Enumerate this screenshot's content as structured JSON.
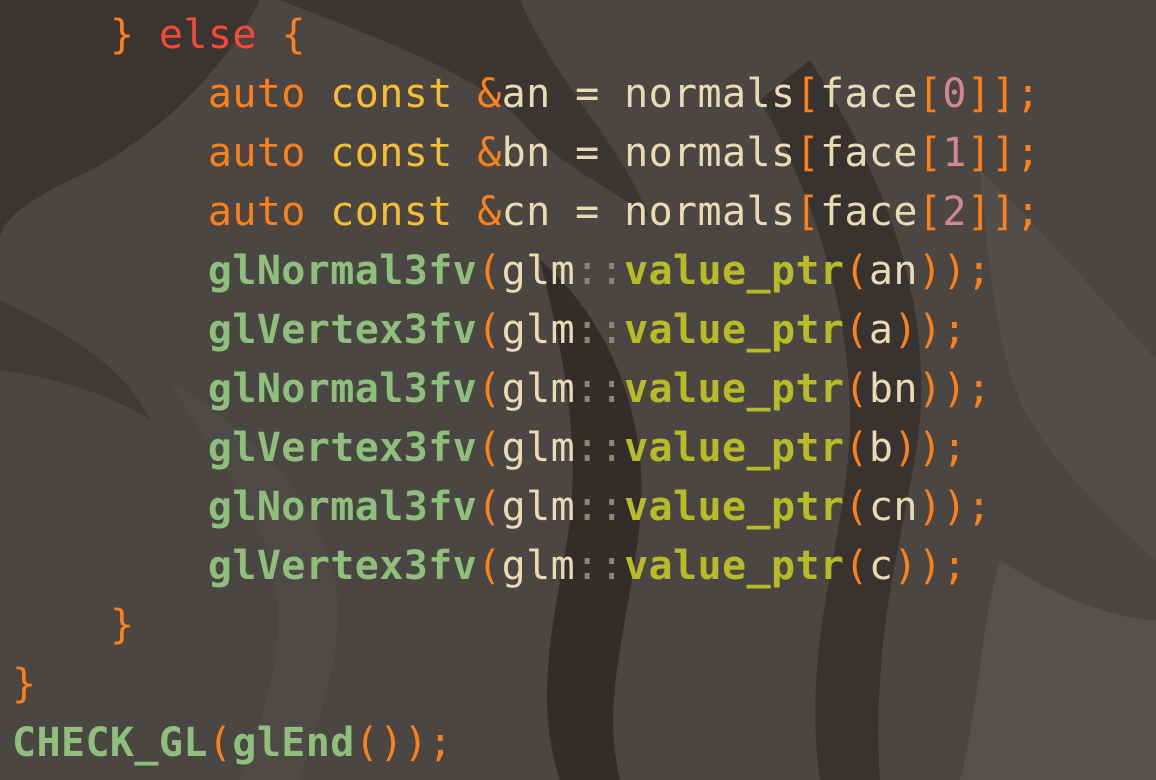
{
  "colors": {
    "background": "#4a4643",
    "plain_text": "#ebdbb2",
    "keyword_orange": "#fe8019",
    "keyword_yellow": "#fabd2f",
    "keyword_red": "#fb4934",
    "function_green": "#8ec07c",
    "method_yellow_green": "#b8bb26",
    "number_purple": "#d3869b",
    "punctuation_gray": "#928374"
  },
  "editor": {
    "lines": [
      {
        "indent": "    ",
        "tokens": [
          {
            "text": "}",
            "color": "#fe8019"
          },
          {
            "text": " ",
            "color": "#ebdbb2"
          },
          {
            "text": "else",
            "color": "#fb4934"
          },
          {
            "text": " ",
            "color": "#ebdbb2"
          },
          {
            "text": "{",
            "color": "#fe8019"
          }
        ]
      },
      {
        "indent": "        ",
        "tokens": [
          {
            "text": "auto",
            "color": "#fe8019"
          },
          {
            "text": " ",
            "color": "#ebdbb2"
          },
          {
            "text": "const",
            "color": "#fabd2f"
          },
          {
            "text": " ",
            "color": "#ebdbb2"
          },
          {
            "text": "&",
            "color": "#fe8019"
          },
          {
            "text": "an",
            "color": "#ebdbb2"
          },
          {
            "text": " ",
            "color": "#ebdbb2"
          },
          {
            "text": "=",
            "color": "#ebdbb2"
          },
          {
            "text": " ",
            "color": "#ebdbb2"
          },
          {
            "text": "normals",
            "color": "#ebdbb2"
          },
          {
            "text": "[",
            "color": "#fe8019"
          },
          {
            "text": "face",
            "color": "#ebdbb2"
          },
          {
            "text": "[",
            "color": "#fe8019"
          },
          {
            "text": "0",
            "color": "#d3869b"
          },
          {
            "text": "]]",
            "color": "#fe8019"
          },
          {
            "text": ";",
            "color": "#fe8019"
          }
        ]
      },
      {
        "indent": "        ",
        "tokens": [
          {
            "text": "auto",
            "color": "#fe8019"
          },
          {
            "text": " ",
            "color": "#ebdbb2"
          },
          {
            "text": "const",
            "color": "#fabd2f"
          },
          {
            "text": " ",
            "color": "#ebdbb2"
          },
          {
            "text": "&",
            "color": "#fe8019"
          },
          {
            "text": "bn",
            "color": "#ebdbb2"
          },
          {
            "text": " ",
            "color": "#ebdbb2"
          },
          {
            "text": "=",
            "color": "#ebdbb2"
          },
          {
            "text": " ",
            "color": "#ebdbb2"
          },
          {
            "text": "normals",
            "color": "#ebdbb2"
          },
          {
            "text": "[",
            "color": "#fe8019"
          },
          {
            "text": "face",
            "color": "#ebdbb2"
          },
          {
            "text": "[",
            "color": "#fe8019"
          },
          {
            "text": "1",
            "color": "#d3869b"
          },
          {
            "text": "]]",
            "color": "#fe8019"
          },
          {
            "text": ";",
            "color": "#fe8019"
          }
        ]
      },
      {
        "indent": "        ",
        "tokens": [
          {
            "text": "auto",
            "color": "#fe8019"
          },
          {
            "text": " ",
            "color": "#ebdbb2"
          },
          {
            "text": "const",
            "color": "#fabd2f"
          },
          {
            "text": " ",
            "color": "#ebdbb2"
          },
          {
            "text": "&",
            "color": "#fe8019"
          },
          {
            "text": "cn",
            "color": "#ebdbb2"
          },
          {
            "text": " ",
            "color": "#ebdbb2"
          },
          {
            "text": "=",
            "color": "#ebdbb2"
          },
          {
            "text": " ",
            "color": "#ebdbb2"
          },
          {
            "text": "normals",
            "color": "#ebdbb2"
          },
          {
            "text": "[",
            "color": "#fe8019"
          },
          {
            "text": "face",
            "color": "#ebdbb2"
          },
          {
            "text": "[",
            "color": "#fe8019"
          },
          {
            "text": "2",
            "color": "#d3869b"
          },
          {
            "text": "]]",
            "color": "#fe8019"
          },
          {
            "text": ";",
            "color": "#fe8019"
          }
        ]
      },
      {
        "indent": "        ",
        "tokens": [
          {
            "text": "glNormal3fv",
            "color": "#8ec07c",
            "bold": true
          },
          {
            "text": "(",
            "color": "#fe8019"
          },
          {
            "text": "glm",
            "color": "#ebdbb2"
          },
          {
            "text": "::",
            "color": "#928374"
          },
          {
            "text": "value_ptr",
            "color": "#b8bb26",
            "bold": true
          },
          {
            "text": "(",
            "color": "#fe8019"
          },
          {
            "text": "an",
            "color": "#ebdbb2"
          },
          {
            "text": "))",
            "color": "#fe8019"
          },
          {
            "text": ";",
            "color": "#fe8019"
          }
        ]
      },
      {
        "indent": "        ",
        "tokens": [
          {
            "text": "glVertex3fv",
            "color": "#8ec07c",
            "bold": true
          },
          {
            "text": "(",
            "color": "#fe8019"
          },
          {
            "text": "glm",
            "color": "#ebdbb2"
          },
          {
            "text": "::",
            "color": "#928374"
          },
          {
            "text": "value_ptr",
            "color": "#b8bb26",
            "bold": true
          },
          {
            "text": "(",
            "color": "#fe8019"
          },
          {
            "text": "a",
            "color": "#ebdbb2"
          },
          {
            "text": "))",
            "color": "#fe8019"
          },
          {
            "text": ";",
            "color": "#fe8019"
          }
        ]
      },
      {
        "indent": "        ",
        "tokens": [
          {
            "text": "glNormal3fv",
            "color": "#8ec07c",
            "bold": true
          },
          {
            "text": "(",
            "color": "#fe8019"
          },
          {
            "text": "glm",
            "color": "#ebdbb2"
          },
          {
            "text": "::",
            "color": "#928374"
          },
          {
            "text": "value_ptr",
            "color": "#b8bb26",
            "bold": true
          },
          {
            "text": "(",
            "color": "#fe8019"
          },
          {
            "text": "bn",
            "color": "#ebdbb2"
          },
          {
            "text": "))",
            "color": "#fe8019"
          },
          {
            "text": ";",
            "color": "#fe8019"
          }
        ]
      },
      {
        "indent": "        ",
        "tokens": [
          {
            "text": "glVertex3fv",
            "color": "#8ec07c",
            "bold": true
          },
          {
            "text": "(",
            "color": "#fe8019"
          },
          {
            "text": "glm",
            "color": "#ebdbb2"
          },
          {
            "text": "::",
            "color": "#928374"
          },
          {
            "text": "value_ptr",
            "color": "#b8bb26",
            "bold": true
          },
          {
            "text": "(",
            "color": "#fe8019"
          },
          {
            "text": "b",
            "color": "#ebdbb2"
          },
          {
            "text": "))",
            "color": "#fe8019"
          },
          {
            "text": ";",
            "color": "#fe8019"
          }
        ]
      },
      {
        "indent": "        ",
        "tokens": [
          {
            "text": "glNormal3fv",
            "color": "#8ec07c",
            "bold": true
          },
          {
            "text": "(",
            "color": "#fe8019"
          },
          {
            "text": "glm",
            "color": "#ebdbb2"
          },
          {
            "text": "::",
            "color": "#928374"
          },
          {
            "text": "value_ptr",
            "color": "#b8bb26",
            "bold": true
          },
          {
            "text": "(",
            "color": "#fe8019"
          },
          {
            "text": "cn",
            "color": "#ebdbb2"
          },
          {
            "text": "))",
            "color": "#fe8019"
          },
          {
            "text": ";",
            "color": "#fe8019"
          }
        ]
      },
      {
        "indent": "        ",
        "tokens": [
          {
            "text": "glVertex3fv",
            "color": "#8ec07c",
            "bold": true
          },
          {
            "text": "(",
            "color": "#fe8019"
          },
          {
            "text": "glm",
            "color": "#ebdbb2"
          },
          {
            "text": "::",
            "color": "#928374"
          },
          {
            "text": "value_ptr",
            "color": "#b8bb26",
            "bold": true
          },
          {
            "text": "(",
            "color": "#fe8019"
          },
          {
            "text": "c",
            "color": "#ebdbb2"
          },
          {
            "text": "))",
            "color": "#fe8019"
          },
          {
            "text": ";",
            "color": "#fe8019"
          }
        ]
      },
      {
        "indent": "    ",
        "tokens": [
          {
            "text": "}",
            "color": "#fe8019"
          }
        ]
      },
      {
        "indent": "",
        "tokens": [
          {
            "text": "}",
            "color": "#fe8019"
          }
        ]
      },
      {
        "indent": "",
        "tokens": [
          {
            "text": "CHECK_GL",
            "color": "#8ec07c",
            "bold": true
          },
          {
            "text": "(",
            "color": "#fe8019"
          },
          {
            "text": "glEnd",
            "color": "#8ec07c",
            "bold": true
          },
          {
            "text": "())",
            "color": "#fe8019"
          },
          {
            "text": ";",
            "color": "#fe8019"
          }
        ]
      }
    ]
  }
}
